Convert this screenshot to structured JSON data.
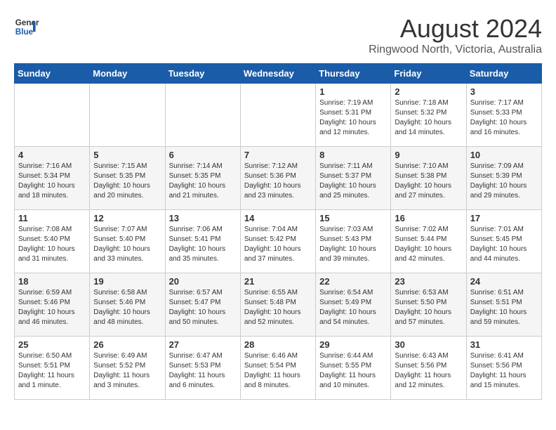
{
  "header": {
    "logo_line1": "General",
    "logo_line2": "Blue",
    "month_year": "August 2024",
    "location": "Ringwood North, Victoria, Australia"
  },
  "days_of_week": [
    "Sunday",
    "Monday",
    "Tuesday",
    "Wednesday",
    "Thursday",
    "Friday",
    "Saturday"
  ],
  "weeks": [
    [
      {
        "day": "",
        "info": ""
      },
      {
        "day": "",
        "info": ""
      },
      {
        "day": "",
        "info": ""
      },
      {
        "day": "",
        "info": ""
      },
      {
        "day": "1",
        "info": "Sunrise: 7:19 AM\nSunset: 5:31 PM\nDaylight: 10 hours\nand 12 minutes."
      },
      {
        "day": "2",
        "info": "Sunrise: 7:18 AM\nSunset: 5:32 PM\nDaylight: 10 hours\nand 14 minutes."
      },
      {
        "day": "3",
        "info": "Sunrise: 7:17 AM\nSunset: 5:33 PM\nDaylight: 10 hours\nand 16 minutes."
      }
    ],
    [
      {
        "day": "4",
        "info": "Sunrise: 7:16 AM\nSunset: 5:34 PM\nDaylight: 10 hours\nand 18 minutes."
      },
      {
        "day": "5",
        "info": "Sunrise: 7:15 AM\nSunset: 5:35 PM\nDaylight: 10 hours\nand 20 minutes."
      },
      {
        "day": "6",
        "info": "Sunrise: 7:14 AM\nSunset: 5:35 PM\nDaylight: 10 hours\nand 21 minutes."
      },
      {
        "day": "7",
        "info": "Sunrise: 7:12 AM\nSunset: 5:36 PM\nDaylight: 10 hours\nand 23 minutes."
      },
      {
        "day": "8",
        "info": "Sunrise: 7:11 AM\nSunset: 5:37 PM\nDaylight: 10 hours\nand 25 minutes."
      },
      {
        "day": "9",
        "info": "Sunrise: 7:10 AM\nSunset: 5:38 PM\nDaylight: 10 hours\nand 27 minutes."
      },
      {
        "day": "10",
        "info": "Sunrise: 7:09 AM\nSunset: 5:39 PM\nDaylight: 10 hours\nand 29 minutes."
      }
    ],
    [
      {
        "day": "11",
        "info": "Sunrise: 7:08 AM\nSunset: 5:40 PM\nDaylight: 10 hours\nand 31 minutes."
      },
      {
        "day": "12",
        "info": "Sunrise: 7:07 AM\nSunset: 5:40 PM\nDaylight: 10 hours\nand 33 minutes."
      },
      {
        "day": "13",
        "info": "Sunrise: 7:06 AM\nSunset: 5:41 PM\nDaylight: 10 hours\nand 35 minutes."
      },
      {
        "day": "14",
        "info": "Sunrise: 7:04 AM\nSunset: 5:42 PM\nDaylight: 10 hours\nand 37 minutes."
      },
      {
        "day": "15",
        "info": "Sunrise: 7:03 AM\nSunset: 5:43 PM\nDaylight: 10 hours\nand 39 minutes."
      },
      {
        "day": "16",
        "info": "Sunrise: 7:02 AM\nSunset: 5:44 PM\nDaylight: 10 hours\nand 42 minutes."
      },
      {
        "day": "17",
        "info": "Sunrise: 7:01 AM\nSunset: 5:45 PM\nDaylight: 10 hours\nand 44 minutes."
      }
    ],
    [
      {
        "day": "18",
        "info": "Sunrise: 6:59 AM\nSunset: 5:46 PM\nDaylight: 10 hours\nand 46 minutes."
      },
      {
        "day": "19",
        "info": "Sunrise: 6:58 AM\nSunset: 5:46 PM\nDaylight: 10 hours\nand 48 minutes."
      },
      {
        "day": "20",
        "info": "Sunrise: 6:57 AM\nSunset: 5:47 PM\nDaylight: 10 hours\nand 50 minutes."
      },
      {
        "day": "21",
        "info": "Sunrise: 6:55 AM\nSunset: 5:48 PM\nDaylight: 10 hours\nand 52 minutes."
      },
      {
        "day": "22",
        "info": "Sunrise: 6:54 AM\nSunset: 5:49 PM\nDaylight: 10 hours\nand 54 minutes."
      },
      {
        "day": "23",
        "info": "Sunrise: 6:53 AM\nSunset: 5:50 PM\nDaylight: 10 hours\nand 57 minutes."
      },
      {
        "day": "24",
        "info": "Sunrise: 6:51 AM\nSunset: 5:51 PM\nDaylight: 10 hours\nand 59 minutes."
      }
    ],
    [
      {
        "day": "25",
        "info": "Sunrise: 6:50 AM\nSunset: 5:51 PM\nDaylight: 11 hours\nand 1 minute."
      },
      {
        "day": "26",
        "info": "Sunrise: 6:49 AM\nSunset: 5:52 PM\nDaylight: 11 hours\nand 3 minutes."
      },
      {
        "day": "27",
        "info": "Sunrise: 6:47 AM\nSunset: 5:53 PM\nDaylight: 11 hours\nand 6 minutes."
      },
      {
        "day": "28",
        "info": "Sunrise: 6:46 AM\nSunset: 5:54 PM\nDaylight: 11 hours\nand 8 minutes."
      },
      {
        "day": "29",
        "info": "Sunrise: 6:44 AM\nSunset: 5:55 PM\nDaylight: 11 hours\nand 10 minutes."
      },
      {
        "day": "30",
        "info": "Sunrise: 6:43 AM\nSunset: 5:56 PM\nDaylight: 11 hours\nand 12 minutes."
      },
      {
        "day": "31",
        "info": "Sunrise: 6:41 AM\nSunset: 5:56 PM\nDaylight: 11 hours\nand 15 minutes."
      }
    ]
  ]
}
